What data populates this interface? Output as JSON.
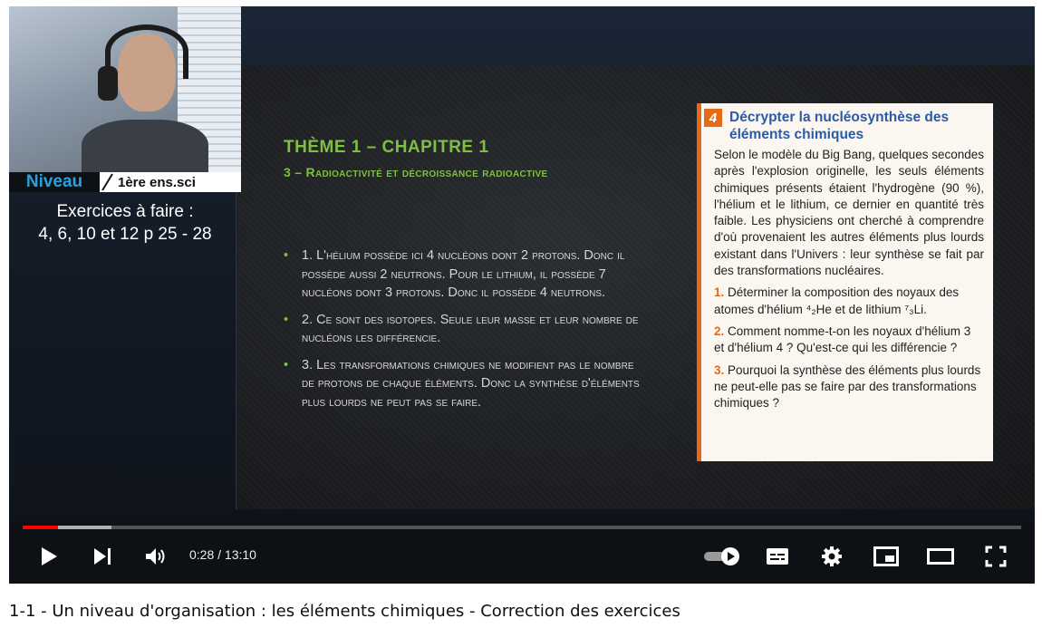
{
  "slide": {
    "theme": "THÈME 1 – CHAPITRE 1",
    "subtitle": "3 – Radioactivité et décroissance radioactive",
    "bullets": [
      "1. L'hélium possède ici 4 nucléons dont 2 protons. Donc il possède aussi 2 neutrons. Pour le lithium, il possède 7 nucléons dont 3 protons. Donc il possède 4 neutrons.",
      "2. Ce sont des isotopes. Seule leur masse et leur nombre de nucléons les différencie.",
      "3. Les transformations chimiques ne modifient pas le nombre de protons de chaque éléments. Donc la synthèse d'éléments plus lourds ne peut pas se faire."
    ],
    "book": {
      "number": "4",
      "title": "Décrypter la nucléosynthèse des éléments chimiques",
      "text": "Selon le modèle du Big Bang, quelques secondes après l'explosion originelle, les seuls éléments chimiques présents étaient l'hydrogène (90 %), l'hélium et le lithium, ce dernier en quantité très faible. Les physiciens ont cherché à comprendre d'où provenaient les autres éléments plus lourds existant dans l'Univers : leur synthèse se fait par des transformations nucléaires.",
      "questions": [
        {
          "num": "1.",
          "text": "Déterminer la composition des noyaux des atomes d'hélium ⁴₂He et de lithium ⁷₃Li."
        },
        {
          "num": "2.",
          "text": "Comment nomme-t-on les noyaux d'hélium 3 et d'hélium 4 ? Qu'est-ce qui les différencie ?"
        },
        {
          "num": "3.",
          "text": "Pourquoi la synthèse des éléments plus lourds ne peut-elle pas se faire par des transformations chimiques ?"
        }
      ]
    }
  },
  "overlay": {
    "niveau_label": "Niveau",
    "niveau_value": "1ère ens.sci",
    "exercises_line1": "Exercices à faire :",
    "exercises_line2": "4, 6, 10 et 12 p 25 - 28"
  },
  "player": {
    "time": "0:28 / 13:10",
    "progress_fraction": 0.0356,
    "buffered_fraction": 0.089,
    "progress_color": "#ff0000"
  },
  "video_title": "1-1 - Un niveau d'organisation : les éléments chimiques - Correction des exercices"
}
